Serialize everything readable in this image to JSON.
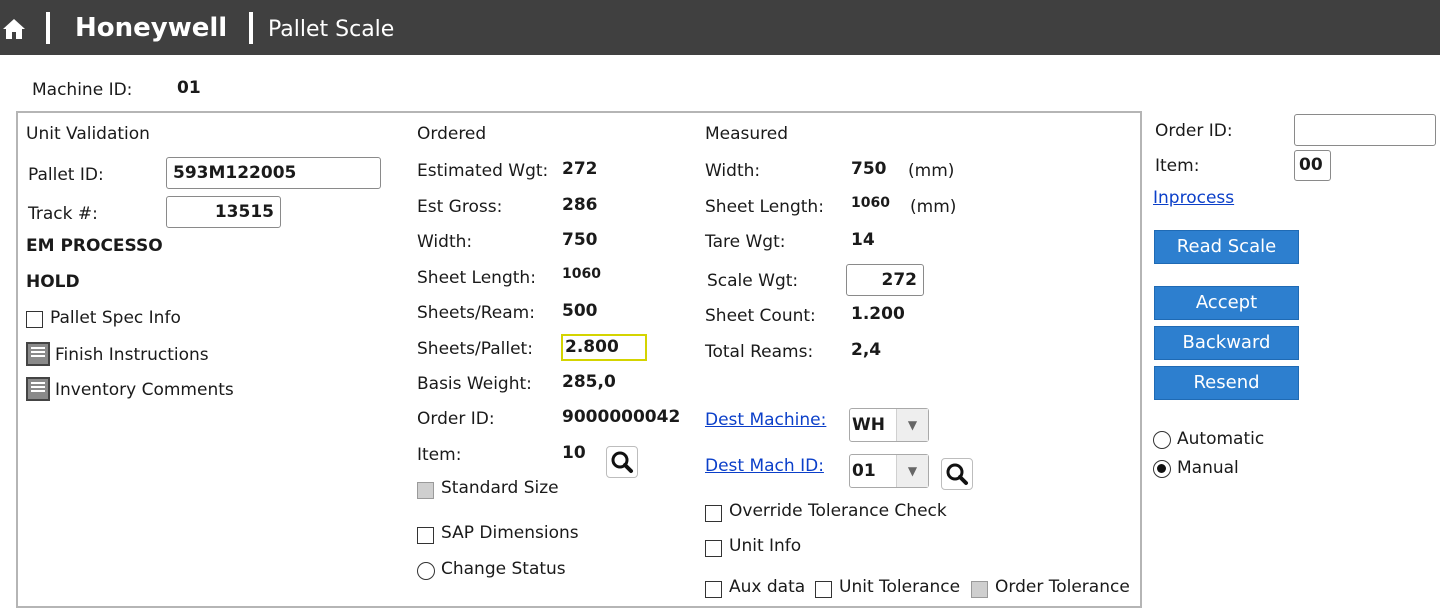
{
  "header": {
    "brand": "Honeywell",
    "title": "Pallet Scale"
  },
  "machine": {
    "label": "Machine ID:",
    "value": "01"
  },
  "unit_validation": {
    "heading": "Unit Validation",
    "pallet_id_label": "Pallet ID:",
    "pallet_id_value": "593M122005",
    "track_label": "Track #:",
    "track_value": "13515",
    "status1": "EM PROCESSO",
    "status2": "HOLD",
    "pallet_spec_info": "Pallet Spec Info",
    "finish_instructions": "Finish Instructions",
    "inventory_comments": "Inventory Comments"
  },
  "ordered": {
    "heading": "Ordered",
    "rows": [
      {
        "label": "Estimated Wgt:",
        "value": "272"
      },
      {
        "label": "Est Gross:",
        "value": "286"
      },
      {
        "label": "Width:",
        "value": "750"
      },
      {
        "label": "Sheet Length:",
        "value": "1060"
      },
      {
        "label": "Sheets/Ream:",
        "value": "500"
      },
      {
        "label": "Sheets/Pallet:",
        "value": "2.800"
      },
      {
        "label": "Basis Weight:",
        "value": "285,0"
      },
      {
        "label": "Order ID:",
        "value": "9000000042"
      },
      {
        "label": "Item:",
        "value": "10"
      }
    ],
    "standard_size": "Standard Size",
    "sap_dimensions": "SAP Dimensions",
    "change_status": "Change Status"
  },
  "measured": {
    "heading": "Measured",
    "width_label": "Width:",
    "width_value": "750",
    "width_unit": "(mm)",
    "sheet_length_label": "Sheet Length:",
    "sheet_length_value": "1060",
    "sheet_length_unit": "(mm)",
    "tare_label": "Tare Wgt:",
    "tare_value": "14",
    "scale_label": "Scale Wgt:",
    "scale_value": "272",
    "sheet_count_label": "Sheet Count:",
    "sheet_count_value": "1.200",
    "total_reams_label": "Total Reams:",
    "total_reams_value": "2,4",
    "dest_machine_label": "Dest Machine:",
    "dest_machine_value": "WH",
    "dest_mach_id_label": "Dest Mach ID:",
    "dest_mach_id_value": "01",
    "override_tolerance": "Override Tolerance Check",
    "unit_info": "Unit Info",
    "aux_data": "Aux data",
    "unit_tolerance": "Unit Tolerance",
    "order_tolerance": "Order Tolerance"
  },
  "right": {
    "order_id_label": "Order ID:",
    "order_id_value": "",
    "item_label": "Item:",
    "item_value": "00",
    "inprocess_link": "Inprocess",
    "read_scale": "Read Scale",
    "accept": "Accept",
    "backward": "Backward",
    "resend": "Resend",
    "automatic": "Automatic",
    "manual": "Manual",
    "mode_selected": "Manual"
  },
  "colors": {
    "header_bg": "#404040",
    "button_bg": "#2d7fcf",
    "link": "#0b3fc9",
    "highlight_border": "#d4d400"
  },
  "icons": [
    "home-icon",
    "search-icon",
    "document-icon",
    "dropdown-arrow-icon"
  ]
}
